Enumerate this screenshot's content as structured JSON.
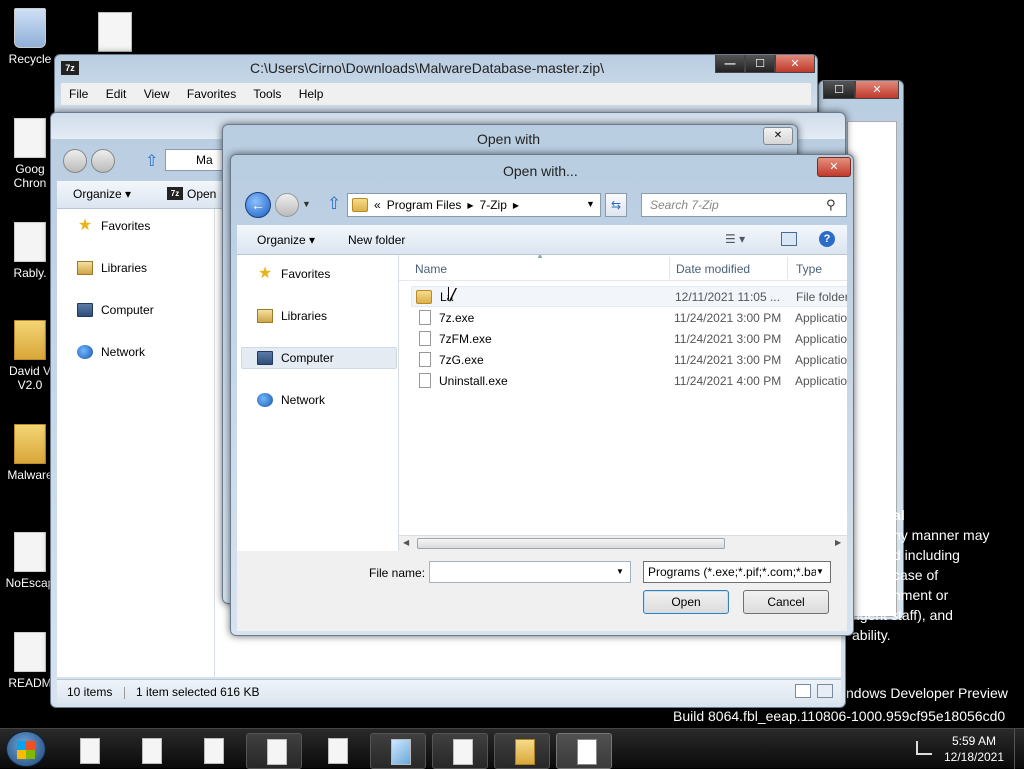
{
  "desktop": {
    "icons": [
      {
        "label": "Recycle"
      },
      {
        "label": "Goog Chron"
      },
      {
        "label": "Rably."
      },
      {
        "label": "David V V2.0"
      },
      {
        "label": "Malware"
      },
      {
        "label": "NoEscap"
      },
      {
        "label": "READM"
      }
    ],
    "background_text": {
      "lines": [
        "al",
        "ny manner may",
        "d including",
        "case of",
        "nment or",
        "ngent staff), and",
        "ability."
      ],
      "watermark_1": "ndows Developer Preview",
      "watermark_2": "Build 8064.fbl_eeap.110806-1000.959cf95e18056cd0"
    }
  },
  "zip_window": {
    "title": "C:\\Users\\Cirno\\Downloads\\MalwareDatabase-master.zip\\",
    "badge": "7z",
    "menu": [
      "File",
      "Edit",
      "View",
      "Favorites",
      "Tools",
      "Help"
    ],
    "controls": {
      "min": "—",
      "max": "☐",
      "close": "✕"
    }
  },
  "explorer_window": {
    "address_short": "Ma",
    "toolbar": {
      "organize": "Organize ▾",
      "open": "Open",
      "open_badge": "7z"
    },
    "nav": [
      "Favorites",
      "Libraries",
      "Computer",
      "Network"
    ],
    "status": {
      "items": "10 items",
      "selected": "1 item selected  616 KB"
    }
  },
  "openwith_back": {
    "title": "Open with",
    "close": "✕"
  },
  "dialog": {
    "title": "Open with...",
    "close": "✕",
    "breadcrumb": [
      "«",
      "Program Files",
      "7-Zip"
    ],
    "search_placeholder": "Search 7-Zip",
    "toolbar": {
      "organize": "Organize ▾",
      "new_folder": "New folder",
      "help": "?"
    },
    "nav": [
      "Favorites",
      "Libraries",
      "Computer",
      "Network"
    ],
    "columns": {
      "name": "Name",
      "date": "Date modified",
      "type": "Type"
    },
    "files": [
      {
        "name": "La",
        "date": "12/11/2021 11:05 ...",
        "type": "File folder",
        "icon": "folder"
      },
      {
        "name": "7z.exe",
        "date": "11/24/2021 3:00 PM",
        "type": "Applicatio",
        "icon": "exe"
      },
      {
        "name": "7zFM.exe",
        "date": "11/24/2021 3:00 PM",
        "type": "Applicatio",
        "icon": "exe"
      },
      {
        "name": "7zG.exe",
        "date": "11/24/2021 3:00 PM",
        "type": "Applicatio",
        "icon": "exe"
      },
      {
        "name": "Uninstall.exe",
        "date": "11/24/2021 4:00 PM",
        "type": "Applicatio",
        "icon": "exe"
      }
    ],
    "filename_label": "File name:",
    "filename_value": "",
    "filter_value": "Programs (*.exe;*.pif;*.com;*.ba",
    "open_button": "Open",
    "cancel_button": "Cancel"
  },
  "taskbar": {
    "time": "5:59 AM",
    "date": "12/18/2021"
  },
  "colors": {
    "accent": "#3a7bd5",
    "selection": "#d9e7f7",
    "close_red": "#c0392b"
  }
}
